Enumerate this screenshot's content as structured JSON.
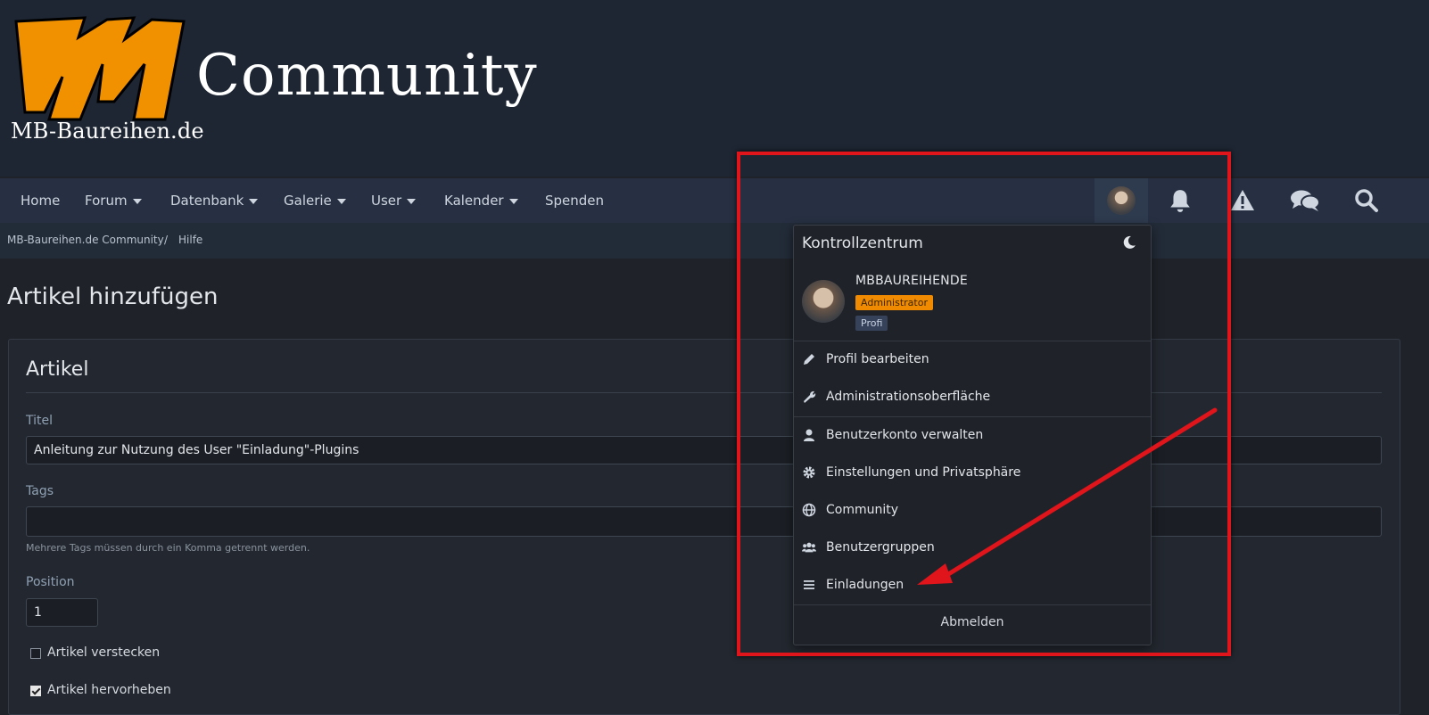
{
  "header": {
    "logo_subtitle": "MB-Baureihen.de",
    "site_title": "Community",
    "logo_color": "#f29100"
  },
  "nav": {
    "items": [
      {
        "label": "Home"
      },
      {
        "label": "Forum"
      },
      {
        "label": "Datenbank"
      },
      {
        "label": "Galerie"
      },
      {
        "label": "User"
      },
      {
        "label": "Kalender"
      },
      {
        "label": "Spenden"
      }
    ],
    "icons": [
      "user-avatar",
      "bell-icon",
      "warning-icon",
      "chat-icon",
      "search-icon"
    ]
  },
  "breadcrumb": {
    "items": [
      "MB-Baureihen.de Community",
      "Hilfe"
    ],
    "separator": "/"
  },
  "page": {
    "title": "Artikel hinzufügen"
  },
  "form": {
    "section_title": "Artikel",
    "title_label": "Titel",
    "title_value": "Anleitung zur Nutzung des User \"Einladung\"-Plugins",
    "tags_label": "Tags",
    "tags_value": "",
    "tags_hint": "Mehrere Tags müssen durch ein Komma getrennt werden.",
    "position_label": "Position",
    "position_value": "1",
    "hide_label": "Artikel verstecken",
    "hide_checked": false,
    "highlight_label": "Artikel hervorheben",
    "highlight_checked": true
  },
  "dropdown": {
    "title": "Kontrollzentrum",
    "username": "MBBAUREIHENDE",
    "badges": [
      "Administrator",
      "Profi"
    ],
    "menu": [
      {
        "label": "Profil bearbeiten",
        "icon": "pencil-icon"
      },
      {
        "label": "Administrationsoberfläche",
        "icon": "wrench-icon"
      },
      {
        "label": "Benutzerkonto verwalten",
        "icon": "user-icon"
      },
      {
        "label": "Einstellungen und Privatsphäre",
        "icon": "gear-icon"
      },
      {
        "label": "Community",
        "icon": "globe-icon"
      },
      {
        "label": "Benutzergruppen",
        "icon": "users-icon"
      },
      {
        "label": "Einladungen",
        "icon": "list-icon"
      }
    ],
    "logout": "Abmelden"
  },
  "annotation": {
    "color": "#e0141b"
  }
}
